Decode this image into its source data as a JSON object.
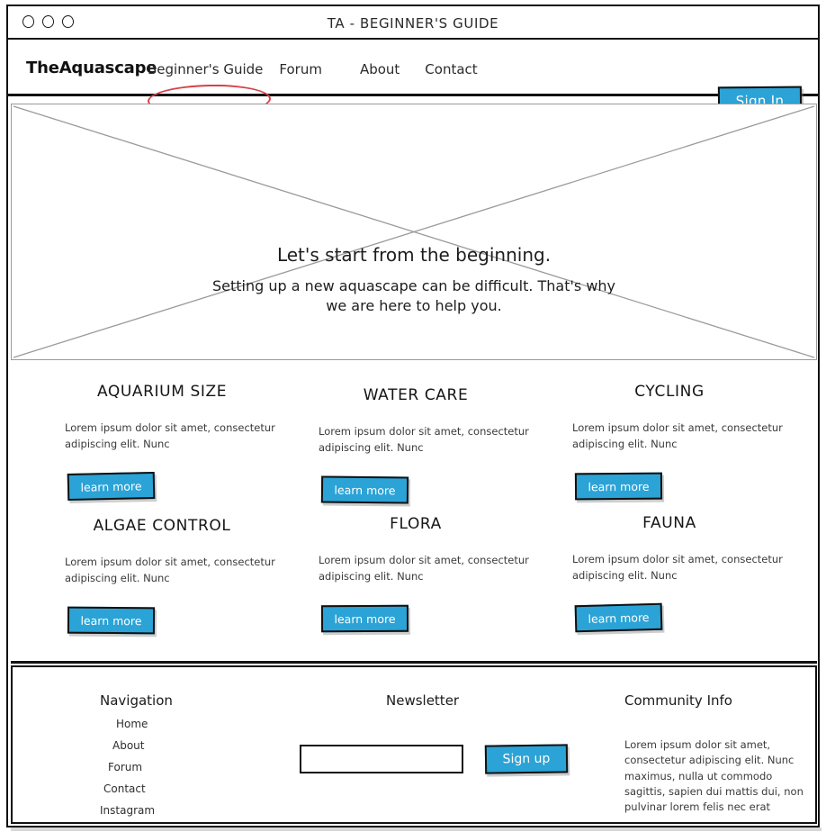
{
  "window": {
    "title": "TA - BEGINNER'S GUIDE",
    "dots": [
      "circle",
      "circle",
      "circle"
    ]
  },
  "navbar": {
    "brand": "TheAquascape",
    "links": [
      {
        "label": "Beginner's Guide",
        "highlighted": true
      },
      {
        "label": "Forum",
        "highlighted": false
      },
      {
        "label": "About",
        "highlighted": false
      },
      {
        "label": "Contact",
        "highlighted": false
      }
    ],
    "signin_label": "Sign In",
    "highlight_color": "#d8404a"
  },
  "hero": {
    "placeholder": "image-placeholder-x-box",
    "title": "Let's start from the beginning.",
    "subtitle_line1": "Setting up a new aquascape can be difficult. That's why",
    "subtitle_line2": "we are here to help you."
  },
  "features": {
    "button_label": "learn more",
    "cards": [
      {
        "title": "AQUARIUM SIZE",
        "body": "Lorem ipsum dolor sit amet, consectetur adipiscing elit. Nunc",
        "button": "learn more"
      },
      {
        "title": "WATER CARE",
        "body": "Lorem ipsum dolor sit amet, consectetur adipiscing elit. Nunc",
        "button": "learn more"
      },
      {
        "title": "CYCLING",
        "body": "Lorem ipsum dolor sit amet, consectetur adipiscing elit. Nunc",
        "button": "learn more"
      },
      {
        "title": "ALGAE CONTROL",
        "body": "Lorem ipsum dolor sit amet, consectetur adipiscing elit. Nunc",
        "button": "learn more"
      },
      {
        "title": "FLORA",
        "body": "Lorem ipsum dolor sit amet, consectetur adipiscing elit. Nunc",
        "button": "learn more"
      },
      {
        "title": "FAUNA",
        "body": "Lorem ipsum dolor sit amet, consectetur adipiscing elit. Nunc",
        "button": "learn more"
      }
    ]
  },
  "footer": {
    "navigation": {
      "title": "Navigation",
      "items": [
        "Home",
        "About",
        "Forum",
        "Contact",
        "Instagram"
      ]
    },
    "newsletter": {
      "title": "Newsletter",
      "input_value": "",
      "input_placeholder": "",
      "button_label": "Sign up"
    },
    "community": {
      "title": "Community Info",
      "body": "Lorem ipsum dolor sit amet, consectetur adipiscing elit. Nunc maximus, nulla ut commodo sagittis, sapien dui mattis dui, non pulvinar lorem felis nec erat"
    }
  },
  "theme": {
    "accent_blue": "#2ba3d6",
    "annotation_red": "#d8404a",
    "line_black": "#111111",
    "placeholder_gray": "#9a9a9a"
  }
}
